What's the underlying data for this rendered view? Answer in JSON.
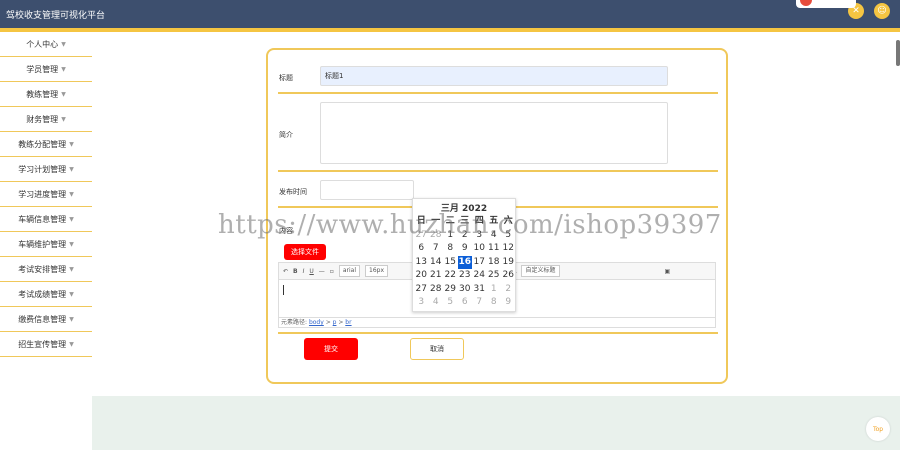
{
  "app": {
    "title": "驾校收支管理可视化平台"
  },
  "sidebar": {
    "items": [
      {
        "label": "个人中心"
      },
      {
        "label": "学员管理"
      },
      {
        "label": "教练管理"
      },
      {
        "label": "财务管理"
      },
      {
        "label": "教练分配管理"
      },
      {
        "label": "学习计划管理"
      },
      {
        "label": "学习进度管理"
      },
      {
        "label": "车辆信息管理"
      },
      {
        "label": "车辆维护管理"
      },
      {
        "label": "考试安排管理"
      },
      {
        "label": "考试成绩管理"
      },
      {
        "label": "缴费信息管理"
      },
      {
        "label": "招生宣传管理"
      }
    ]
  },
  "form": {
    "title_label": "标题",
    "title_value": "标题1",
    "intro_label": "简介",
    "date_label": "发布时间",
    "content_label": "内容",
    "file_button": "选择文件",
    "submit_label": "提交",
    "cancel_label": "取消"
  },
  "editor": {
    "font_value": "arial",
    "size_value": "16px",
    "style_value": "自定义标题",
    "path_label": "元素路径:",
    "path_items": [
      "body",
      "p",
      "br"
    ]
  },
  "calendar": {
    "header": "三月 2022",
    "weekdays": [
      "日",
      "一",
      "二",
      "三",
      "四",
      "五",
      "六"
    ],
    "weeks": [
      [
        "27",
        "28",
        "1",
        "2",
        "3",
        "4",
        "5"
      ],
      [
        "6",
        "7",
        "8",
        "9",
        "10",
        "11",
        "12"
      ],
      [
        "13",
        "14",
        "15",
        "16",
        "17",
        "18",
        "19"
      ],
      [
        "20",
        "21",
        "22",
        "23",
        "24",
        "25",
        "26"
      ],
      [
        "27",
        "28",
        "29",
        "30",
        "31",
        "1",
        "2"
      ],
      [
        "3",
        "4",
        "5",
        "6",
        "7",
        "8",
        "9"
      ]
    ],
    "selected": "16"
  },
  "watermark": "https://www.huzhan.com/ishop39397",
  "top_button": "Top",
  "colors": {
    "accent": "#f0c85a",
    "header": "#3d4f6e",
    "primary": "#ff0000",
    "selected": "#0b5ed7"
  }
}
